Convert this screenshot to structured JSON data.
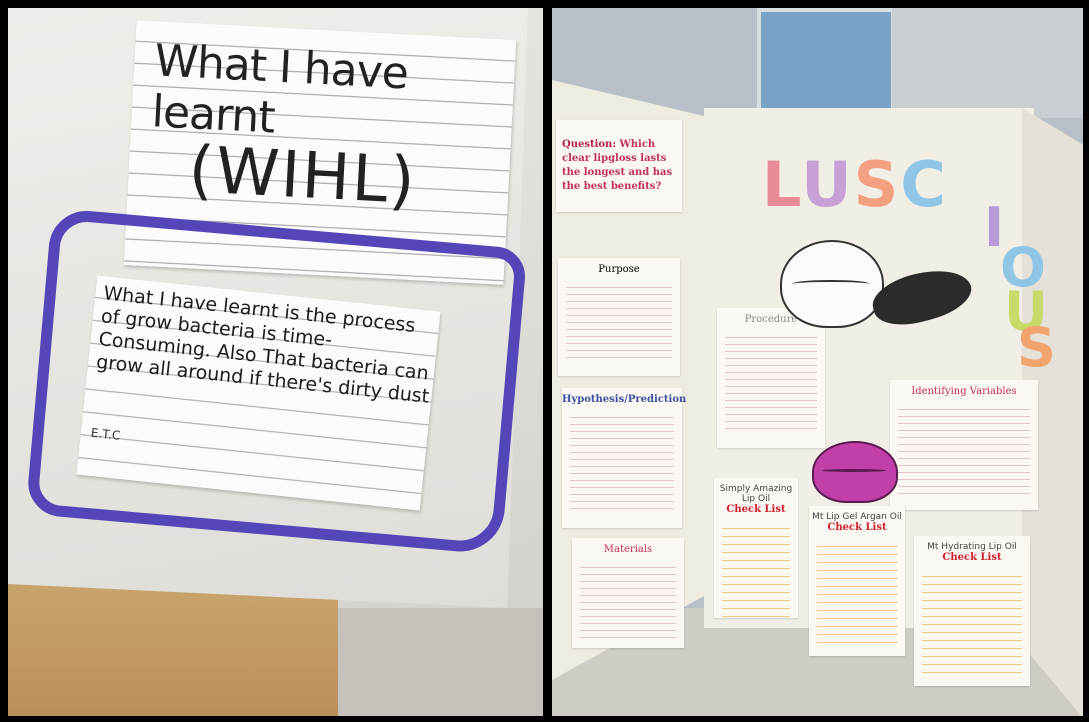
{
  "left_photo": {
    "title_card": {
      "line1": "What I have learnt",
      "line2": "(WIHL)"
    },
    "note_card": {
      "text": "What I have learnt is the process of grow bacteria is time-Consuming. Also That bacteria can grow all around if there's dirty dust",
      "etc": "E.T.C"
    }
  },
  "right_photo": {
    "question": {
      "prefix": "Question:",
      "text": "Which clear lipgloss lasts the longest and has the best benefits?"
    },
    "purpose_heading": "Purpose",
    "hypothesis_heading": "Hypothesis/Prediction",
    "materials_heading": "Materials",
    "procedure_heading": "Procedure",
    "variables_heading": "Identifying Variables",
    "title_letters": [
      "L",
      "U",
      "S",
      "C",
      "I",
      "O",
      "U",
      "S"
    ],
    "checklist_title": "Check List",
    "checklist_names": [
      "Simply Amazing Lip Oil",
      "Mt Lip Gel Argan Oil",
      "Mt Hydrating Lip Oil"
    ]
  },
  "colors": {
    "pipe_cleaner": "#5446b8",
    "question_red": "#c2305a",
    "lips_pink": "#c23faa"
  }
}
